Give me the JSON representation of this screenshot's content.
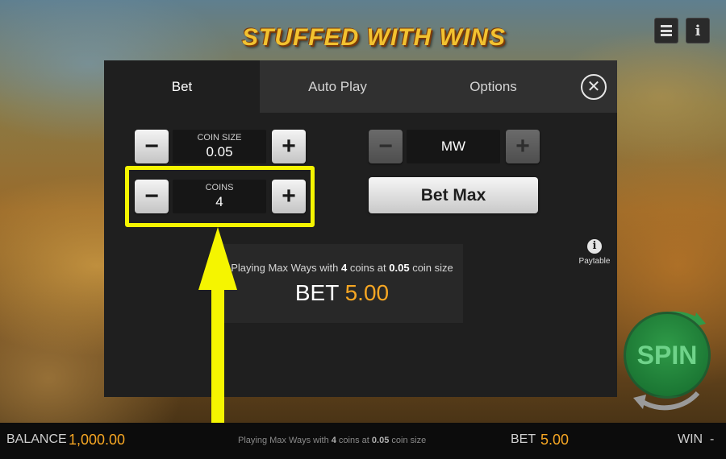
{
  "game": {
    "logo_text": "STUFFED WITH WINS"
  },
  "top_buttons": {
    "menu_icon": "hamburger-menu-icon",
    "info_icon": "info-icon",
    "info_glyph": "i"
  },
  "modal": {
    "tabs": [
      {
        "label": "Bet",
        "active": true
      },
      {
        "label": "Auto Play",
        "active": false
      },
      {
        "label": "Options",
        "active": false
      }
    ],
    "close_glyph": "✕",
    "coin_size": {
      "label": "COIN SIZE",
      "value": "0.05",
      "minus": "−",
      "plus": "+"
    },
    "coins": {
      "label": "COINS",
      "value": "4",
      "minus": "−",
      "plus": "+"
    },
    "ways": {
      "value": "MW",
      "minus": "−",
      "plus": "+",
      "disabled": true
    },
    "bet_max_label": "Bet Max",
    "paytable": {
      "glyph": "i",
      "label": "Paytable"
    },
    "summary": {
      "prefix": "Playing Max Ways with ",
      "coins": "4",
      "middle": " coins at ",
      "coin_size": "0.05",
      "suffix": " coin size",
      "bet_label": "BET",
      "bet_value": "5.00"
    }
  },
  "annotation": {
    "highlight_color": "#f5f500"
  },
  "spin": {
    "label": "SPIN"
  },
  "bottom_bar": {
    "balance_label": "BALANCE",
    "balance_value": "1,000.00",
    "info_prefix": "Playing Max Ways with ",
    "info_coins": "4",
    "info_middle": " coins at ",
    "info_coin_size": "0.05",
    "info_suffix": " coin size",
    "bet_label": "BET",
    "bet_value": "5.00",
    "win_label": "WIN",
    "win_value": "-"
  },
  "colors": {
    "accent": "#f6a623",
    "spin_green": "#2f9a48"
  }
}
